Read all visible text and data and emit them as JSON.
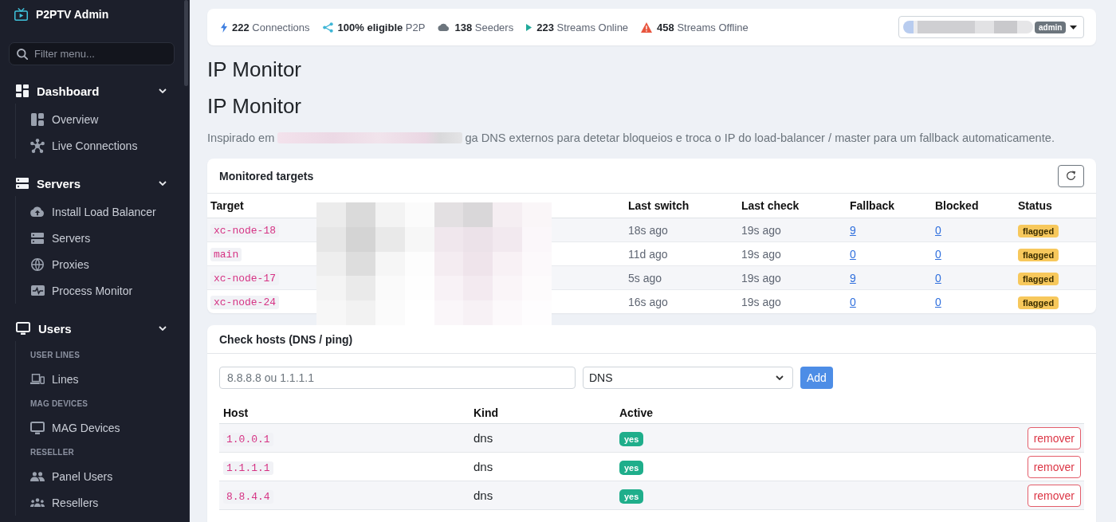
{
  "sidebar": {
    "brand": "P2PTV Admin",
    "filter": {
      "placeholder": "Filter menu..."
    },
    "groups": [
      {
        "label": "Dashboard",
        "expanded": true,
        "items": [
          {
            "kind": "link",
            "label": "Overview"
          },
          {
            "kind": "link",
            "label": "Live Connections"
          }
        ]
      },
      {
        "label": "Servers",
        "expanded": true,
        "items": [
          {
            "kind": "link",
            "label": "Install Load Balancer"
          },
          {
            "kind": "link",
            "label": "Servers"
          },
          {
            "kind": "link",
            "label": "Proxies"
          },
          {
            "kind": "link",
            "label": "Process Monitor"
          }
        ]
      },
      {
        "label": "Users",
        "expanded": true,
        "items": [
          {
            "kind": "heading",
            "label": "USER LINES"
          },
          {
            "kind": "link",
            "label": "Lines"
          },
          {
            "kind": "heading",
            "label": "MAG DEVICES"
          },
          {
            "kind": "link",
            "label": "MAG Devices"
          },
          {
            "kind": "heading",
            "label": "RESELLER"
          },
          {
            "kind": "link",
            "label": "Panel Users"
          },
          {
            "kind": "link",
            "label": "Resellers"
          }
        ]
      }
    ]
  },
  "top_bar": {
    "stats": [
      {
        "text": "**222** Connections"
      },
      {
        "text": "**100% eligible** P2P"
      },
      {
        "text": "**138** Seeders"
      },
      {
        "text": "**223** Streams Online"
      },
      {
        "text": "**458** Streams Offline"
      }
    ],
    "user_menu": {
      "role_badge": "admin"
    }
  },
  "page": {
    "titles": [
      "IP Monitor",
      "IP Monitor"
    ],
    "description": {
      "text_1": "Inspirado em",
      "text_2": "ga DNS externos para detetar bloqueios e troca o IP do load-balancer / master para um fallback automaticamente."
    }
  },
  "monitored_targets": {
    "title": "Monitored targets",
    "columns": [
      "Target",
      "Last switch",
      "Last check",
      "Fallback",
      "Blocked",
      "Status"
    ],
    "rows": [
      {
        "target": "xc-node-18",
        "last_switch": "18s ago",
        "last_check": "19s ago",
        "fallback": "9",
        "blocked": "0",
        "status": "flagged"
      },
      {
        "target": "main",
        "last_switch": "11d ago",
        "last_check": "19s ago",
        "fallback": "0",
        "blocked": "0",
        "status": "flagged"
      },
      {
        "target": "xc-node-17",
        "last_switch": "5s ago",
        "last_check": "19s ago",
        "fallback": "9",
        "blocked": "0",
        "status": "flagged"
      },
      {
        "target": "xc-node-24",
        "last_switch": "16s ago",
        "last_check": "19s ago",
        "fallback": "0",
        "blocked": "0",
        "status": "flagged"
      }
    ]
  },
  "check_hosts": {
    "title": "Check hosts (DNS / ping)",
    "host_field": {
      "placeholder": "8.8.8.8 ou 1.1.1.1"
    },
    "kind_select": {
      "value": "DNS"
    },
    "add_button": "Add",
    "columns": [
      "Host",
      "Kind",
      "Active"
    ],
    "rows": [
      {
        "host": "1.0.0.1",
        "protocol": "dns",
        "active": "yes",
        "action": "remover"
      },
      {
        "host": "1.1.1.1",
        "protocol": "dns",
        "active": "yes",
        "action": "remover"
      },
      {
        "host": "8.8.4.4",
        "protocol": "dns",
        "active": "yes",
        "action": "remover"
      }
    ]
  }
}
